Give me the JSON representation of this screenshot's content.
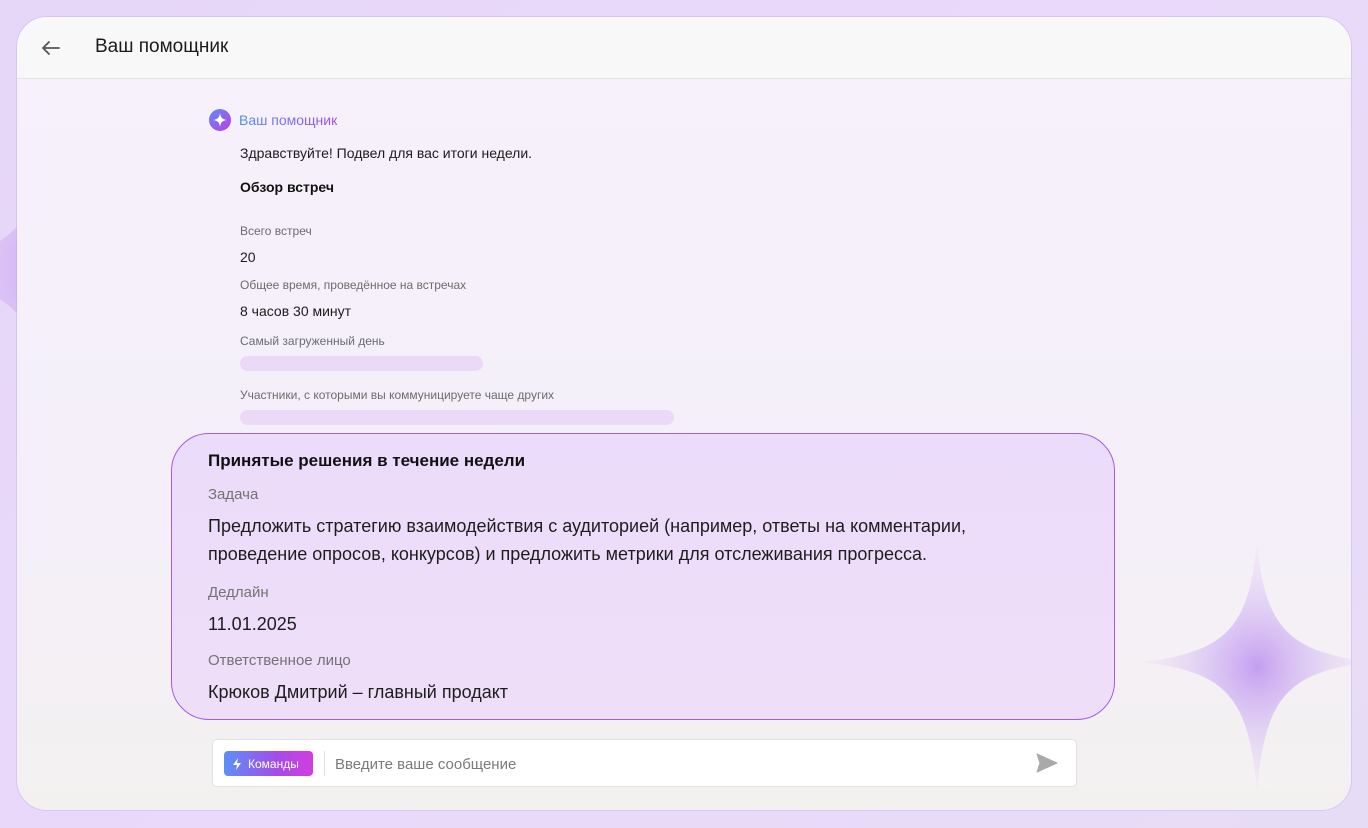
{
  "header": {
    "back_icon": "arrow-left-icon",
    "title": "Ваш помощник"
  },
  "assistant": {
    "avatar_icon": "sparkle-icon",
    "name": "Ваш помощник",
    "greeting": "Здравствуйте! Подвел для вас итоги недели.",
    "overview": {
      "title": "Обзор встреч",
      "total_label": "Всего встреч",
      "total_value": "20",
      "time_label": "Общее время, проведённое на встречах",
      "time_value": "8 часов 30 минут",
      "busiest_day_label": "Самый загруженный день",
      "participants_label": "Участники, с которыми вы коммуницируете чаще других"
    }
  },
  "decisions": {
    "title": "Принятые решения в течение недели",
    "task_label": "Задача",
    "task_value": "Предложить стратегию взаимодействия с аудиторией (например, ответы на комментарии, проведение опросов, конкурсов) и предложить метрики для отслеживания прогресса.",
    "deadline_label": "Дедлайн",
    "deadline_value": "11.01.2025",
    "owner_label": "Ответственное лицо",
    "owner_value": "Крюков Дмитрий – главный продакт"
  },
  "composer": {
    "commands_label": "Команды",
    "commands_icon": "lightning-icon",
    "placeholder": "Введите ваше сообщение",
    "send_icon": "send-icon"
  },
  "colors": {
    "accent_purple": "#a35ce3",
    "accent_blue": "#4f8ff5",
    "card_bg": "#ecdcfb"
  }
}
